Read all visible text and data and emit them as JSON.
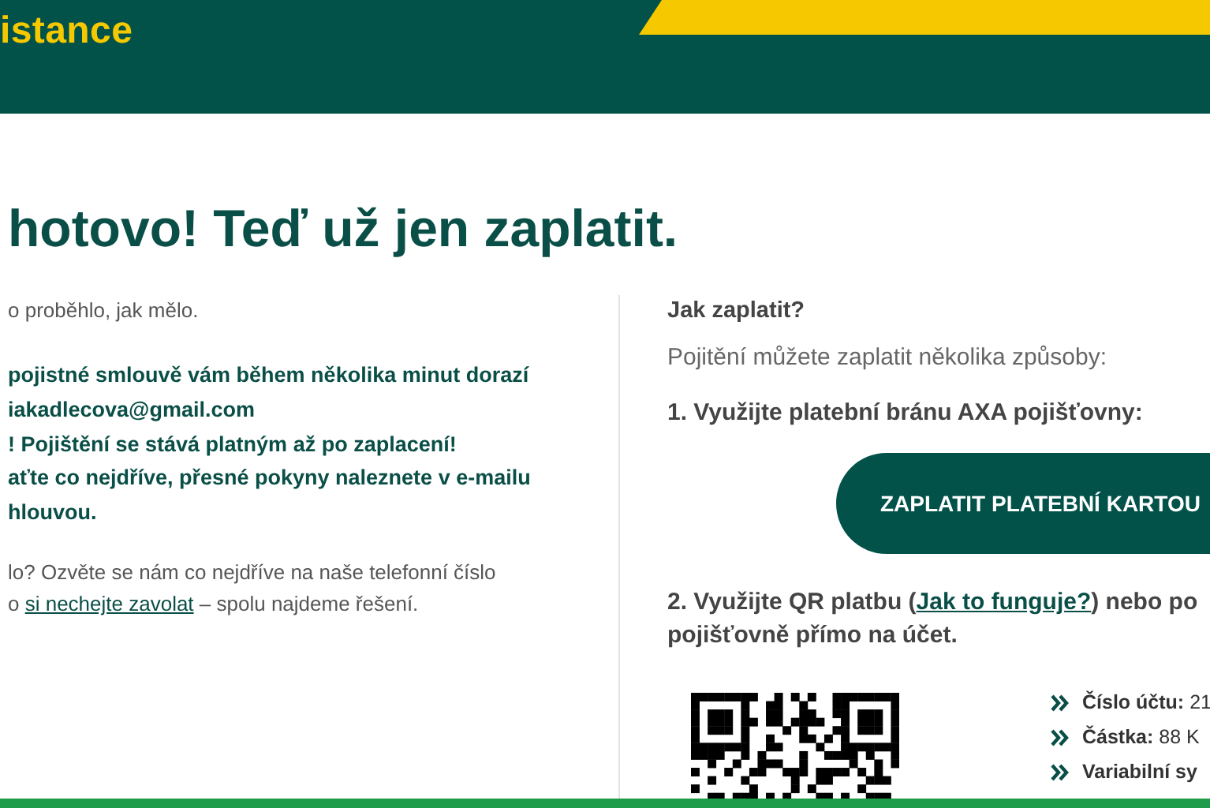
{
  "header": {
    "brand_fragment": "istance"
  },
  "heading": "hotovo! Teď už jen zaplatit.",
  "left": {
    "intro": "o proběhlo, jak mělo.",
    "notice_lines": [
      "pojistné smlouvě vám během několika minut dorazí",
      "iakadlecova@gmail.com",
      "! Pojištění se stává platným až po zaplacení!",
      "aťte co nejdříve, přesné pokyny naleznete v e-mailu",
      "hlouvou."
    ],
    "help": {
      "line1": "lo? Ozvěte se nám co nejdříve na naše telefonní číslo",
      "before": "o ",
      "link": "si nechejte zavolat",
      "after": " – spolu najdeme řešení."
    }
  },
  "right": {
    "title": "Jak zaplatit?",
    "intro": "Pojitění můžete zaplatit několika způsoby:",
    "option1": "1. Využijte platební bránu AXA pojišťovny:",
    "pay_button": "ZAPLATIT PLATEBNÍ KARTOU",
    "option2": {
      "before": "2. Využijte QR platbu (",
      "link": "Jak to funguje?",
      "after": ") nebo po",
      "continuation": "pojišťovně přímo na účet."
    },
    "details": [
      {
        "label": "Číslo účtu:",
        "value": "21"
      },
      {
        "label": "Částka:",
        "value": "88 K"
      },
      {
        "label": "Variabilní sy"
      }
    ]
  }
}
